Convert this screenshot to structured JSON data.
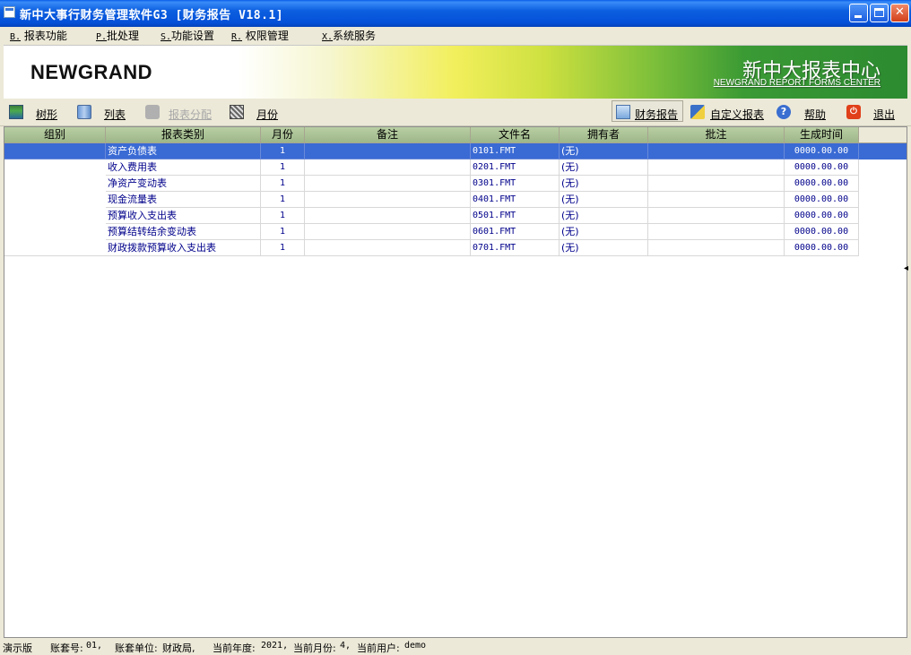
{
  "window": {
    "title": "新中大事行财务管理软件G3 [财务报告 V18.1]"
  },
  "menu": [
    {
      "key": "B.",
      "label": "报表功能"
    },
    {
      "key": "P.",
      "label": "批处理"
    },
    {
      "key": "S.",
      "label": "功能设置"
    },
    {
      "key": "R.",
      "label": "权限管理"
    },
    {
      "key": "X.",
      "label": "系统服务"
    }
  ],
  "banner": {
    "logo": "NEWGRAND",
    "center_title": "新中大报表中心",
    "center_subtitle": "NEWGRAND REPORT FORMS CENTER"
  },
  "toolbar": {
    "tree": "树形",
    "list": "列表",
    "distribute": "报表分配",
    "month": "月份",
    "finance_report": "财务报告",
    "custom_report": "自定义报表",
    "help": "帮助",
    "exit": "退出"
  },
  "grid": {
    "columns": [
      "组别",
      "报表类别",
      "月份",
      "备注",
      "文件名",
      "拥有者",
      "批注",
      "生成时间"
    ],
    "rows": [
      {
        "group": "",
        "category": "资产负债表",
        "month": "1",
        "note": "",
        "file": "0101.FMT",
        "owner": "(无)",
        "annot": "",
        "time": "0000.00.00"
      },
      {
        "group": "",
        "category": "收入费用表",
        "month": "1",
        "note": "",
        "file": "0201.FMT",
        "owner": "(无)",
        "annot": "",
        "time": "0000.00.00"
      },
      {
        "group": "",
        "category": "净资产变动表",
        "month": "1",
        "note": "",
        "file": "0301.FMT",
        "owner": "(无)",
        "annot": "",
        "time": "0000.00.00"
      },
      {
        "group": "",
        "category": "现金流量表",
        "month": "1",
        "note": "",
        "file": "0401.FMT",
        "owner": "(无)",
        "annot": "",
        "time": "0000.00.00"
      },
      {
        "group": "",
        "category": "预算收入支出表",
        "month": "1",
        "note": "",
        "file": "0501.FMT",
        "owner": "(无)",
        "annot": "",
        "time": "0000.00.00"
      },
      {
        "group": "",
        "category": "预算结转结余变动表",
        "month": "1",
        "note": "",
        "file": "0601.FMT",
        "owner": "(无)",
        "annot": "",
        "time": "0000.00.00"
      },
      {
        "group": "",
        "category": "财政拨款预算收入支出表",
        "month": "1",
        "note": "",
        "file": "0701.FMT",
        "owner": "(无)",
        "annot": "",
        "time": "0000.00.00"
      }
    ]
  },
  "status": {
    "edition": "演示版",
    "account_label": "账套号:",
    "account": "01,",
    "unit_label": "账套单位:",
    "unit": "财政局,",
    "year_label": "当前年度:",
    "year": "2021,",
    "month_label": "当前月份:",
    "month": "4,",
    "user_label": "当前用户:",
    "user": "demo"
  }
}
